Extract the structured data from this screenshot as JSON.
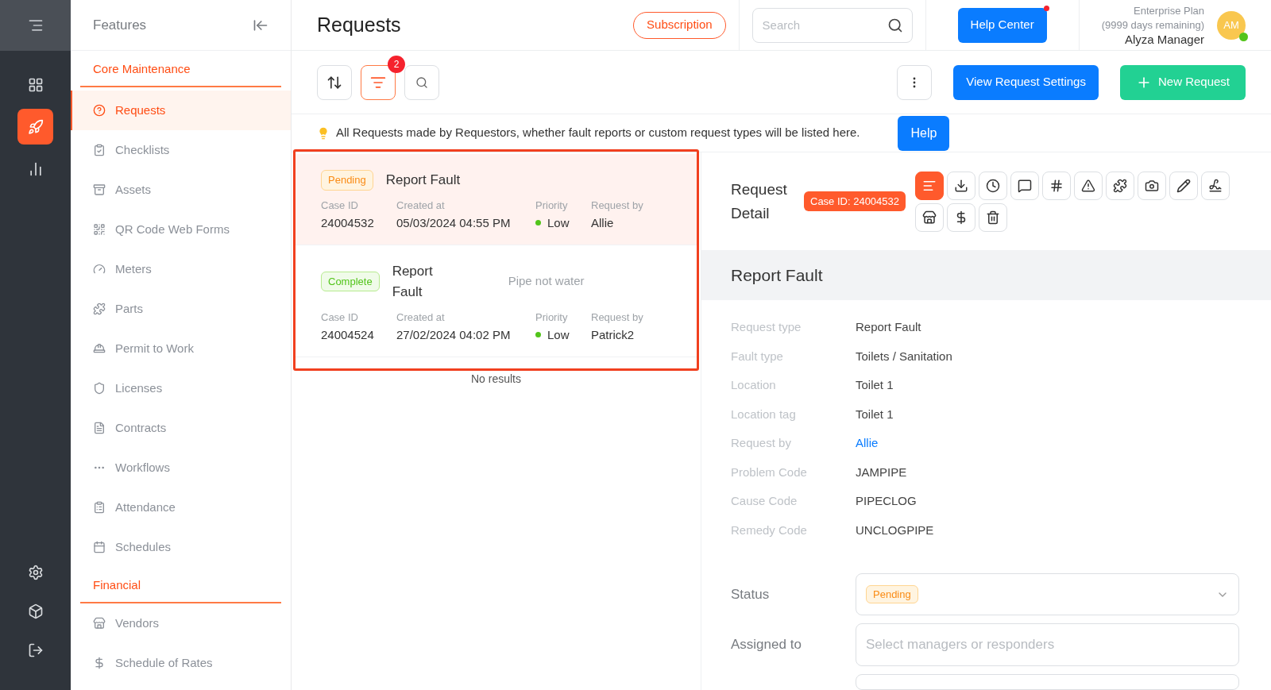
{
  "rail": {
    "top": [
      {
        "selected": false
      },
      {
        "selected": true
      },
      {
        "selected": false
      }
    ],
    "bottom": [
      {
        "selected": false
      },
      {
        "selected": false
      },
      {
        "selected": false
      }
    ]
  },
  "sidebar": {
    "title": "Features",
    "sections": [
      {
        "title": "Core Maintenance",
        "items": [
          {
            "label": "Requests",
            "selected": true
          },
          {
            "label": "Checklists",
            "selected": false
          },
          {
            "label": "Assets",
            "selected": false
          },
          {
            "label": "QR Code Web Forms",
            "selected": false
          },
          {
            "label": "Meters",
            "selected": false
          },
          {
            "label": "Parts",
            "selected": false
          },
          {
            "label": "Permit to Work",
            "selected": false
          },
          {
            "label": "Licenses",
            "selected": false
          },
          {
            "label": "Contracts",
            "selected": false
          },
          {
            "label": "Workflows",
            "selected": false
          },
          {
            "label": "Attendance",
            "selected": false
          },
          {
            "label": "Schedules",
            "selected": false
          }
        ]
      },
      {
        "title": "Financial",
        "items": [
          {
            "label": "Vendors",
            "selected": false
          },
          {
            "label": "Schedule of Rates",
            "selected": false
          }
        ]
      }
    ]
  },
  "header": {
    "title": "Requests",
    "subscription": "Subscription",
    "search_placeholder": "Search",
    "help_center": "Help Center",
    "plan": "Enterprise Plan",
    "days": "(9999 days remaining)",
    "user": "Alyza Manager",
    "avatar": "AM"
  },
  "toolbar": {
    "filter_count": "2",
    "settings": "View Request Settings",
    "new": "New Request"
  },
  "info": {
    "text": "All Requests made by Requestors, whether fault reports or custom request types will be listed here.",
    "help": "Help"
  },
  "requests": [
    {
      "status": {
        "label": "Pending",
        "kind": "pending"
      },
      "title": "Report Fault",
      "selected": true,
      "fields": [
        {
          "label": "Case ID",
          "value": "24004532"
        },
        {
          "label": "Created at",
          "value": "05/03/2024 04:55 PM"
        },
        {
          "label": "Priority",
          "value": "Low",
          "color": "#52c41a"
        },
        {
          "label": "Request by",
          "value": "Allie"
        }
      ]
    },
    {
      "status": {
        "label": "Complete",
        "kind": "complete"
      },
      "title": "Report Fault",
      "note": "Pipe not water",
      "selected": false,
      "fields": [
        {
          "label": "Case ID",
          "value": "24004524"
        },
        {
          "label": "Created at",
          "value": "27/02/2024 04:02 PM"
        },
        {
          "label": "Priority",
          "value": "Low",
          "color": "#52c41a"
        },
        {
          "label": "Request by",
          "value": "Patrick2"
        }
      ]
    }
  ],
  "no_results": "No results",
  "detail": {
    "heading": "Request Detail",
    "case_badge": "Case ID: 24004532",
    "actions": [
      {
        "selected": true
      },
      {
        "selected": false
      },
      {
        "selected": false
      },
      {
        "selected": false
      },
      {
        "selected": false
      },
      {
        "selected": false
      },
      {
        "selected": false
      },
      {
        "selected": false
      },
      {
        "selected": false
      },
      {
        "selected": false
      },
      {
        "selected": false
      },
      {
        "selected": false
      },
      {
        "selected": false
      }
    ],
    "section_title": "Report Fault",
    "fields": [
      {
        "label": "Request type",
        "value": "Report Fault"
      },
      {
        "label": "Fault type",
        "value": "Toilets / Sanitation"
      },
      {
        "label": "Location",
        "value": "Toilet 1"
      },
      {
        "label": "Location tag",
        "value": "Toilet 1"
      },
      {
        "label": "Request by",
        "value": "Allie",
        "kind": "link"
      },
      {
        "label": "Problem Code",
        "value": "JAMPIPE"
      },
      {
        "label": "Cause Code",
        "value": "PIPECLOG"
      },
      {
        "label": "Remedy Code",
        "value": "UNCLOGPIPE"
      }
    ],
    "status": {
      "label": "Status",
      "value": "Pending",
      "kind": "pending"
    },
    "assigned": {
      "label": "Assigned to",
      "placeholder": "Select managers or responders"
    }
  }
}
